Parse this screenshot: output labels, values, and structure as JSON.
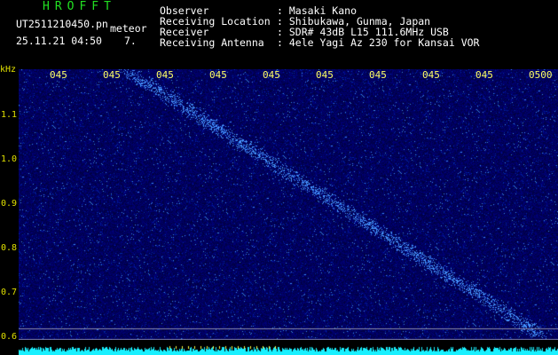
{
  "header": {
    "logo": "HROFFT",
    "filename": "UT2511210450.pn",
    "tag": "meteor",
    "datetime": "25.11.21 04:50",
    "count": "7.",
    "fields": [
      {
        "key": "Observer",
        "value": ": Masaki Kano"
      },
      {
        "key": "Receiving Location",
        "value": ": Shibukawa, Gunma, Japan"
      },
      {
        "key": "Receiver",
        "value": ": SDR# 43dB L15 111.6MHz USB"
      },
      {
        "key": "Receiving Antenna",
        "value": ": 4ele Yagi Az 230 for Kansai VOR"
      }
    ]
  },
  "axis": {
    "unit": "kHz",
    "y_ticks": [
      "1.1",
      "1.0",
      "0.9",
      "0.8",
      "0.7",
      "0.6"
    ],
    "x_ticks": [
      "045",
      "045",
      "045",
      "045",
      "045",
      "045",
      "045",
      "045",
      "045",
      "0500"
    ]
  },
  "colors": {
    "background": "#000000",
    "plot_bg": "#00007a",
    "meteor": "#4aa0ff",
    "spectrum": "#19f0ff",
    "axis_text": "#e0e000"
  }
}
